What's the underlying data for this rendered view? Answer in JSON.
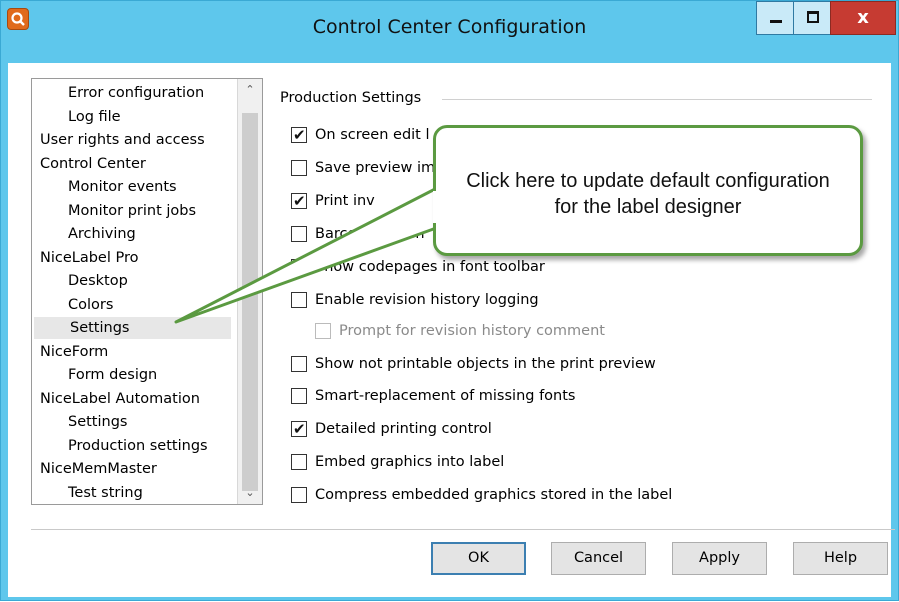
{
  "window": {
    "title": "Control Center Configuration",
    "minimize_label": "–",
    "close_label": "x"
  },
  "tree": {
    "items": [
      {
        "label": "Error configuration",
        "level": 1
      },
      {
        "label": "Log file",
        "level": 1
      },
      {
        "label": "User rights and access",
        "level": 0
      },
      {
        "label": "Control Center",
        "level": 0
      },
      {
        "label": "Monitor events",
        "level": 1
      },
      {
        "label": "Monitor print jobs",
        "level": 1
      },
      {
        "label": "Archiving",
        "level": 1
      },
      {
        "label": "NiceLabel Pro",
        "level": 0
      },
      {
        "label": "Desktop",
        "level": 1
      },
      {
        "label": "Colors",
        "level": 1
      },
      {
        "label": "Settings",
        "level": 1,
        "selected": true
      },
      {
        "label": "NiceForm",
        "level": 0
      },
      {
        "label": "Form design",
        "level": 1
      },
      {
        "label": "NiceLabel Automation",
        "level": 0
      },
      {
        "label": "Settings",
        "level": 1
      },
      {
        "label": "Production settings",
        "level": 1
      },
      {
        "label": "NiceMemMaster",
        "level": 0
      },
      {
        "label": "Test string",
        "level": 1
      }
    ],
    "scroll_up": "⌃",
    "scroll_down": "⌄"
  },
  "settings": {
    "group_title": "Production Settings",
    "options": [
      {
        "label": "On screen edit l",
        "checked": true,
        "disabled": false
      },
      {
        "label": "Save preview im",
        "checked": false,
        "disabled": false
      },
      {
        "label": "Print inv",
        "checked": true,
        "disabled": false
      },
      {
        "label": "Barcode dimen",
        "checked": false,
        "disabled": false
      },
      {
        "label": "Show codepages in font toolbar",
        "checked": false,
        "disabled": false
      },
      {
        "label": "Enable revision history logging",
        "checked": false,
        "disabled": false
      },
      {
        "label": "Prompt for revision history comment",
        "checked": false,
        "disabled": true
      },
      {
        "label": "Show not printable objects in the print preview",
        "checked": false,
        "disabled": false
      },
      {
        "label": "Smart-replacement of missing fonts",
        "checked": false,
        "disabled": false
      },
      {
        "label": "Detailed printing control",
        "checked": true,
        "disabled": false
      },
      {
        "label": "Embed graphics into label",
        "checked": false,
        "disabled": false
      },
      {
        "label": "Compress embedded graphics stored in the label",
        "checked": false,
        "disabled": false
      }
    ]
  },
  "buttons": {
    "ok": "OK",
    "cancel": "Cancel",
    "apply": "Apply",
    "help": "Help"
  },
  "callout": {
    "text": "Click here to update default configuration for the label designer",
    "border_color": "#5b9a41"
  },
  "colors": {
    "titlebar": "#5ec7ec",
    "close_button": "#c63b32",
    "selection": "#e7e7e7"
  }
}
